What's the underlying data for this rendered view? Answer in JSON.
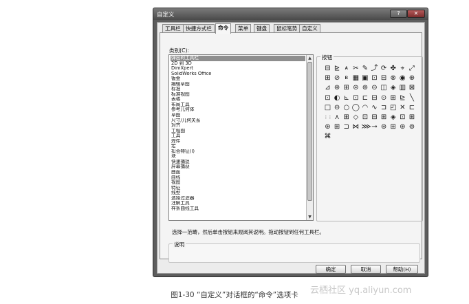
{
  "window": {
    "title": "自定义",
    "help_glyph": "?",
    "close_glyph": "✕"
  },
  "tabs": [
    {
      "label": "工具栏",
      "active": false
    },
    {
      "label": "快捷方式栏",
      "active": false
    },
    {
      "label": "命令",
      "active": true
    },
    {
      "label": "菜单",
      "active": false
    },
    {
      "label": "键盘",
      "active": false
    },
    {
      "label": "鼠标笔势",
      "active": false
    },
    {
      "label": "自定义",
      "active": false
    }
  ],
  "categories": {
    "label": "类别(C):",
    "selected_index": 0,
    "items": [
      "弹出的工具栏",
      "2D 到 3D",
      "DimXpert",
      "SolidWorks Office",
      "钣金",
      "编辑草图",
      "标准",
      "标准视图",
      "表格",
      "布局工具",
      "参考几何体",
      "草图",
      "尺寸/几何关系",
      "对齐",
      "工程图",
      "工具",
      "焊件",
      "宏",
      "扣合特征(I)",
      "块",
      "快速捕捉",
      "屏幕捕获",
      "曲面",
      "曲线",
      "视图",
      "特征",
      "线型",
      "选择过滤器",
      "注解工具",
      "样条曲线工具"
    ]
  },
  "buttons_group": {
    "label": "按钮",
    "icons": [
      "⊟",
      "⊵",
      "𝐀",
      "✂",
      "✎",
      "⤴",
      "⟳",
      "✤",
      "⌖",
      "⤢",
      "⊞",
      "⊘",
      "𝐁",
      "▦",
      "▣",
      "⊡",
      "⊟",
      "⊗",
      "◉",
      "⊕",
      "⊿",
      "⊛",
      "⊞",
      "⊜",
      "⊚",
      "⊝",
      "◫",
      "◈",
      "▥",
      "⊠",
      "⊡",
      "◐",
      "⊾",
      "⊡",
      "⊏",
      "⊟",
      "⊙",
      "⊞",
      "⊵",
      "╲",
      "□",
      "⊖",
      "○",
      "◯",
      "◠",
      "∿",
      "⊐",
      "◰",
      "✕",
      "⊏",
      "⋮⋮",
      "⋏",
      "⊞",
      "◇",
      "⊡",
      "⊟",
      "⊞",
      "◈",
      "⊡",
      "⊞",
      "⊛",
      "⊞",
      "⊐",
      "⋈",
      "⋙",
      "⊸",
      "⊛",
      "⊞",
      "⊛",
      "⊚",
      "⌘"
    ]
  },
  "hint_text": "选择一范畴，然后单击按钮来观阅其说明。拖动按钮到任何工具栏。",
  "description_label": "说明",
  "footer": {
    "ok_label": "确定",
    "cancel_label": "取消",
    "help_label": "帮助(H)"
  },
  "caption": "图1-30 “自定义”对话框的“命令”选项卡",
  "watermark": "云栖社区 yq.aliyun.com"
}
